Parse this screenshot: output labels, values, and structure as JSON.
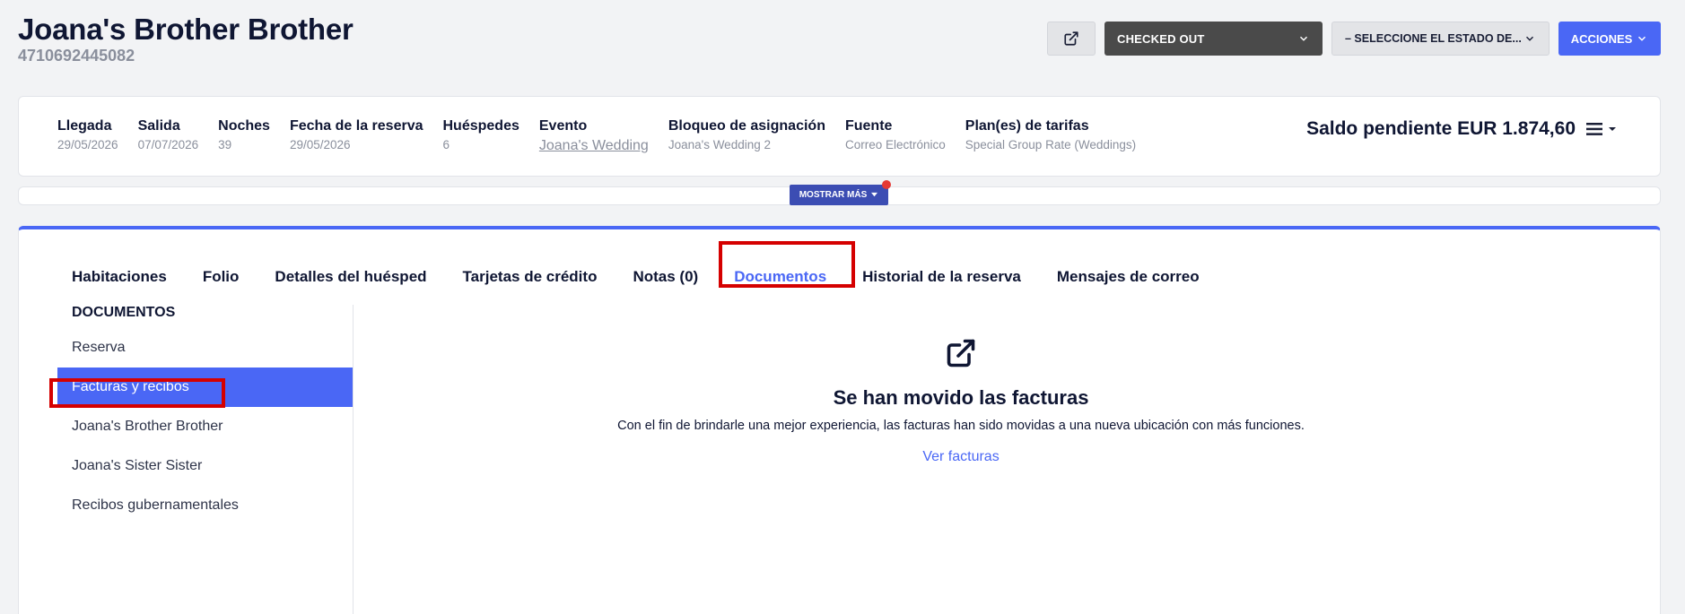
{
  "header": {
    "guest_name": "Joana's Brother Brother",
    "reservation_number": "4710692445082"
  },
  "actions": {
    "status": "CHECKED OUT",
    "select_state": "– SELECCIONE EL ESTADO DE...",
    "actions_label": "ACCIONES"
  },
  "summary": {
    "fields": [
      {
        "label": "Llegada",
        "value": "29/05/2026"
      },
      {
        "label": "Salida",
        "value": "07/07/2026"
      },
      {
        "label": "Noches",
        "value": "39"
      },
      {
        "label": "Fecha de la reserva",
        "value": "29/05/2026"
      },
      {
        "label": "Huéspedes",
        "value": "6"
      },
      {
        "label": "Evento",
        "value": "Joana's Wedding"
      },
      {
        "label": "Bloqueo de asignación",
        "value": "Joana's Wedding 2"
      },
      {
        "label": "Fuente",
        "value": "Correo Electrónico"
      },
      {
        "label": "Plan(es) de tarifas",
        "value": "Special Group Rate (Weddings)"
      }
    ],
    "balance": "Saldo pendiente EUR 1.874,60"
  },
  "show_more": "MOSTRAR MÁS",
  "tabs": [
    {
      "label": "Habitaciones"
    },
    {
      "label": "Folio"
    },
    {
      "label": "Detalles del huésped"
    },
    {
      "label": "Tarjetas de crédito"
    },
    {
      "label": "Notas (0)"
    },
    {
      "label": "Documentos"
    },
    {
      "label": "Historial de la reserva"
    },
    {
      "label": "Mensajes de correo"
    }
  ],
  "sidebar": {
    "title": "DOCUMENTOS",
    "items": [
      {
        "label": "Reserva"
      },
      {
        "label": "Facturas y recibos"
      },
      {
        "label": "Joana's Brother Brother"
      },
      {
        "label": "Joana's Sister Sister"
      },
      {
        "label": "Recibos gubernamentales"
      }
    ]
  },
  "content": {
    "icon": "external-link-icon",
    "title": "Se han movido las facturas",
    "description": "Con el fin de brindarle una mejor experiencia, las facturas han sido movidas a una nueva ubicación con más funciones.",
    "link": "Ver facturas"
  },
  "colors": {
    "accent": "#4a67f5",
    "highlight": "#d50000",
    "dark_button": "#4a4a4a"
  }
}
